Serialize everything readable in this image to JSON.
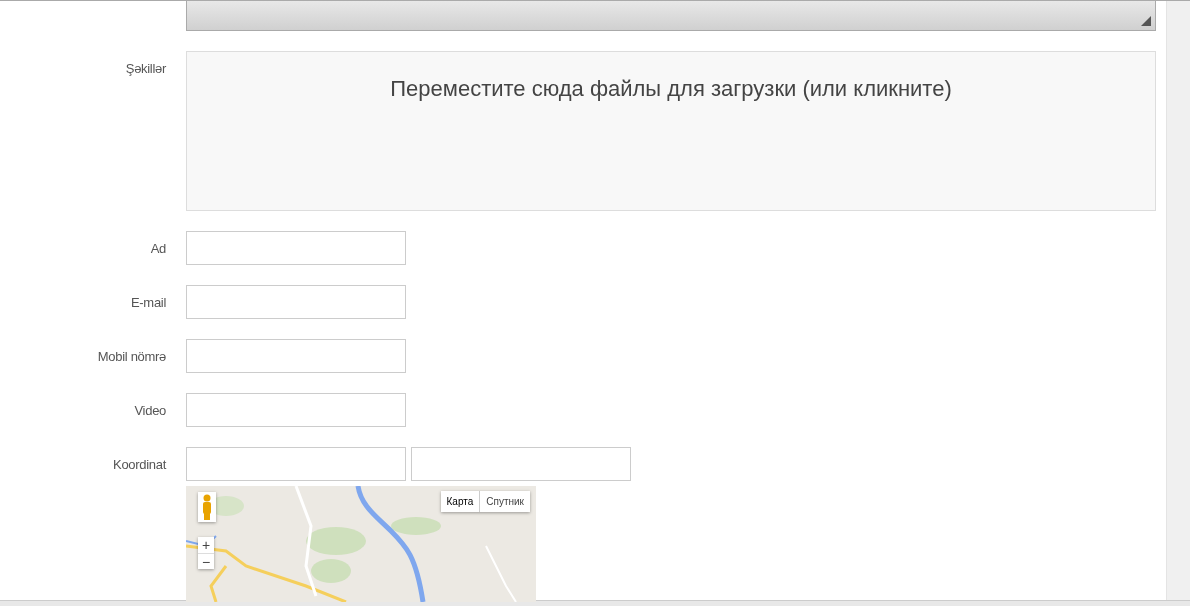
{
  "images": {
    "label": "Şəkillər",
    "dropzone_text": "Переместите сюда файлы для загрузки (или кликните)"
  },
  "fields": [
    {
      "label": "Ad",
      "kind": "single"
    },
    {
      "label": "E-mail",
      "kind": "single"
    },
    {
      "label": "Mobil nömrə",
      "kind": "single"
    },
    {
      "label": "Video",
      "kind": "single"
    },
    {
      "label": "Koordinat",
      "kind": "pair"
    }
  ],
  "map": {
    "zoom_in": "+",
    "zoom_out": "−",
    "map_types": [
      {
        "label": "Карта",
        "selected": true
      },
      {
        "label": "Спутник",
        "selected": false
      }
    ]
  }
}
